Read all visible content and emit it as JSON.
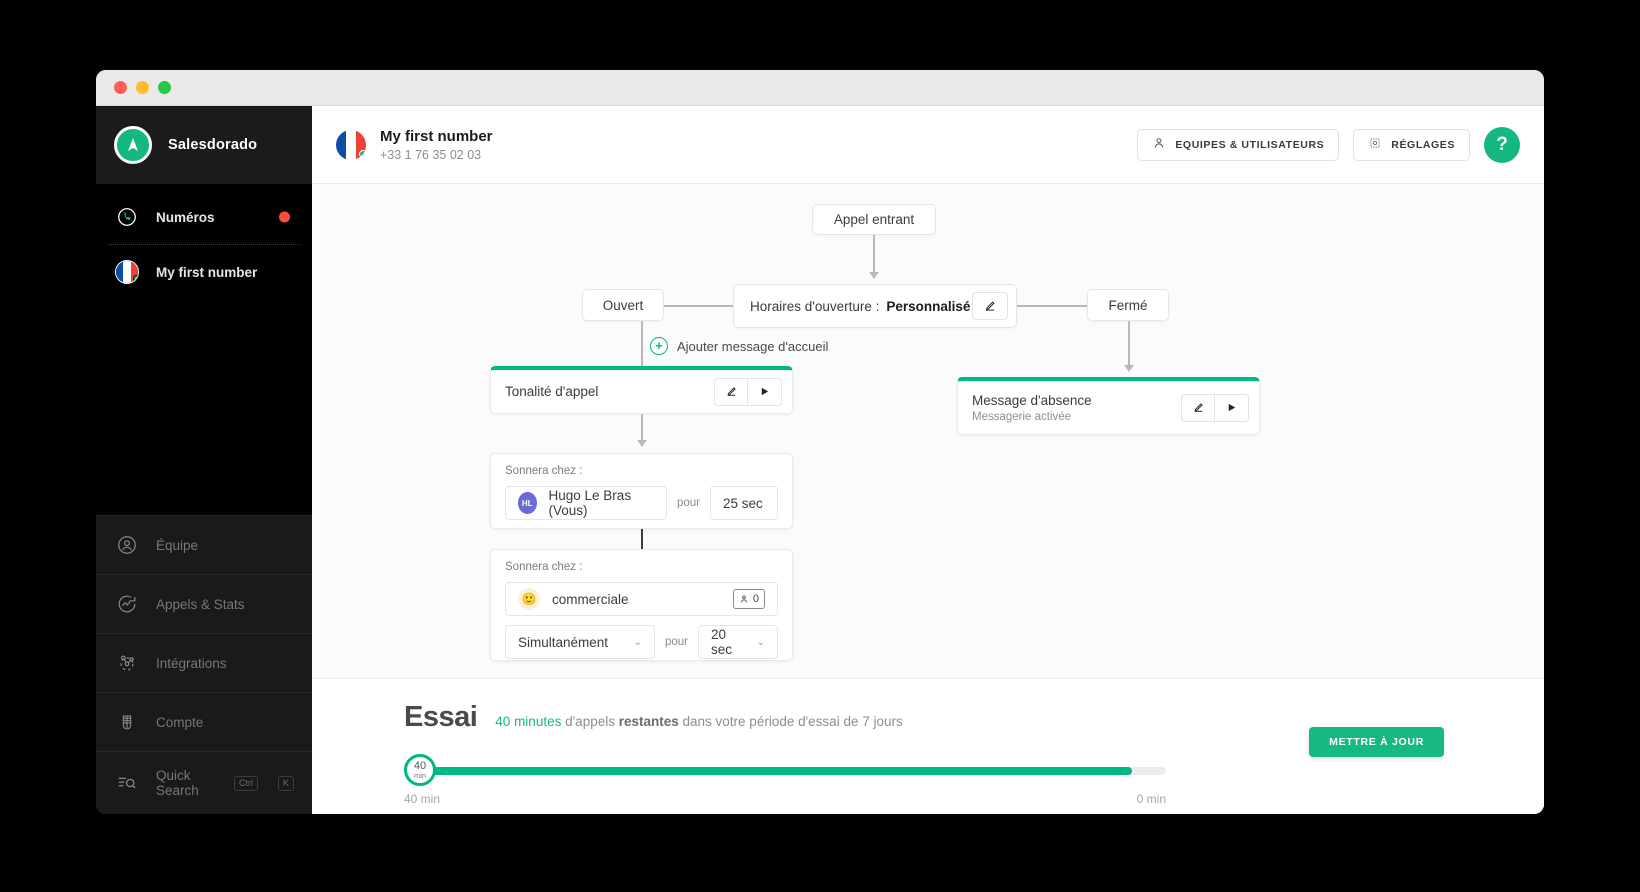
{
  "window": {
    "traffic_lights": [
      "close",
      "minimize",
      "maximize"
    ]
  },
  "sidebar": {
    "brand": {
      "name": "Salesdorado",
      "logo_icon": "salesdorado-logo-icon"
    },
    "top_items": [
      {
        "label": "Numéros",
        "icon": "phone-circle-icon",
        "badge": true
      },
      {
        "label": "My first number",
        "icon": "france-flag-icon",
        "online": true
      }
    ],
    "bottom_items": [
      {
        "label": "Équipe",
        "icon": "user-circle-icon"
      },
      {
        "label": "Appels & Stats",
        "icon": "analytics-circle-icon"
      },
      {
        "label": "Intégrations",
        "icon": "integrations-icon"
      },
      {
        "label": "Compte",
        "icon": "account-grid-icon"
      }
    ],
    "quick_search": {
      "label": "Quick Search",
      "icon": "quick-search-icon",
      "keys": [
        "Ctrl",
        "K"
      ]
    }
  },
  "topbar": {
    "number_name": "My first number",
    "number_phone": "+33 1 76 35 02 03",
    "flag_icon": "france-flag-icon",
    "teams_button": {
      "label": "EQUIPES & UTILISATEURS",
      "icon": "user-icon"
    },
    "settings_button": {
      "label": "RÉGLAGES",
      "icon": "gear-icon"
    },
    "help_button": {
      "label": "?",
      "icon": "help-icon"
    }
  },
  "flow": {
    "incoming_call": "Appel entrant",
    "open_branch": "Ouvert",
    "closed_branch": "Fermé",
    "hours_label": "Horaires d'ouverture :",
    "hours_value": "Personnalisé",
    "add_greeting": "Ajouter message d'accueil",
    "ringtone_card": {
      "title": "Tonalité d'appel",
      "edit_icon": "pencil-icon",
      "play_icon": "play-icon"
    },
    "absence_card": {
      "title": "Message d'absence",
      "subtitle": "Messagerie activée",
      "edit_icon": "pencil-icon",
      "play_icon": "play-icon"
    },
    "ring_group_1": {
      "heading": "Sonnera chez :",
      "member": "Hugo Le Bras (Vous)",
      "member_initials": "HL",
      "for_label": "pour",
      "duration": "25 sec"
    },
    "ring_group_2": {
      "heading": "Sonnera chez :",
      "team": "commerciale",
      "team_emoji": "🙂",
      "member_count": "0",
      "count_icon": "person-icon",
      "mode": "Simultanément",
      "for_label": "pour",
      "duration": "20 sec"
    }
  },
  "trial": {
    "title": "Essai",
    "desc_highlight": "40 minutes",
    "desc_mid": " d'appels ",
    "desc_bold": "restantes",
    "desc_end": " dans votre période d'essai de 7 jours",
    "knob_value": "40",
    "knob_unit": "min",
    "left_label": "40 min",
    "right_label": "0 min",
    "update_button": "METTRE À JOUR"
  },
  "colors": {
    "accent_green": "#00b884",
    "brand_green": "#14b87e",
    "badge_red": "#ff4d3d",
    "sidebar_bg": "#000000"
  }
}
